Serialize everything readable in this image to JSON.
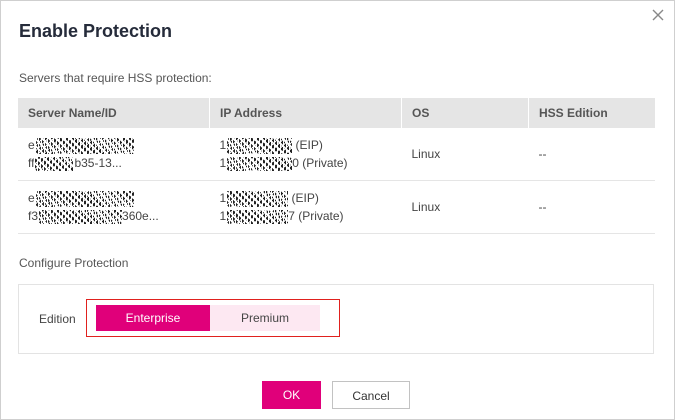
{
  "dialog": {
    "title": "Enable Protection",
    "subtitle": "Servers that require HSS protection:",
    "close_icon": "close-icon"
  },
  "table": {
    "columns": [
      "Server Name/ID",
      "IP Address",
      "OS",
      "HSS Edition"
    ],
    "rows": [
      {
        "name_line1": "e",
        "id_prefix": "ff",
        "id_suffix": "b35-13...",
        "ip_prefix1": "1",
        "ip_suffix1": "(EIP)",
        "ip_prefix2": "1",
        "ip_suffix2": "0 (Private)",
        "os": "Linux",
        "edition": "--"
      },
      {
        "name_line1": "e",
        "id_prefix": "f3",
        "id_suffix": "360e...",
        "ip_prefix1": "1",
        "ip_suffix1": "(EIP)",
        "ip_prefix2": "1",
        "ip_suffix2": "7 (Private)",
        "os": "Linux",
        "edition": "--"
      }
    ]
  },
  "configure": {
    "section_label": "Configure Protection",
    "edition_label": "Edition",
    "options": [
      "Enterprise",
      "Premium"
    ],
    "selected": "Enterprise"
  },
  "footer": {
    "ok_label": "OK",
    "cancel_label": "Cancel"
  },
  "colors": {
    "accent": "#e0007a",
    "accent_light": "#fde8f2",
    "highlight_border": "#e0211e"
  }
}
